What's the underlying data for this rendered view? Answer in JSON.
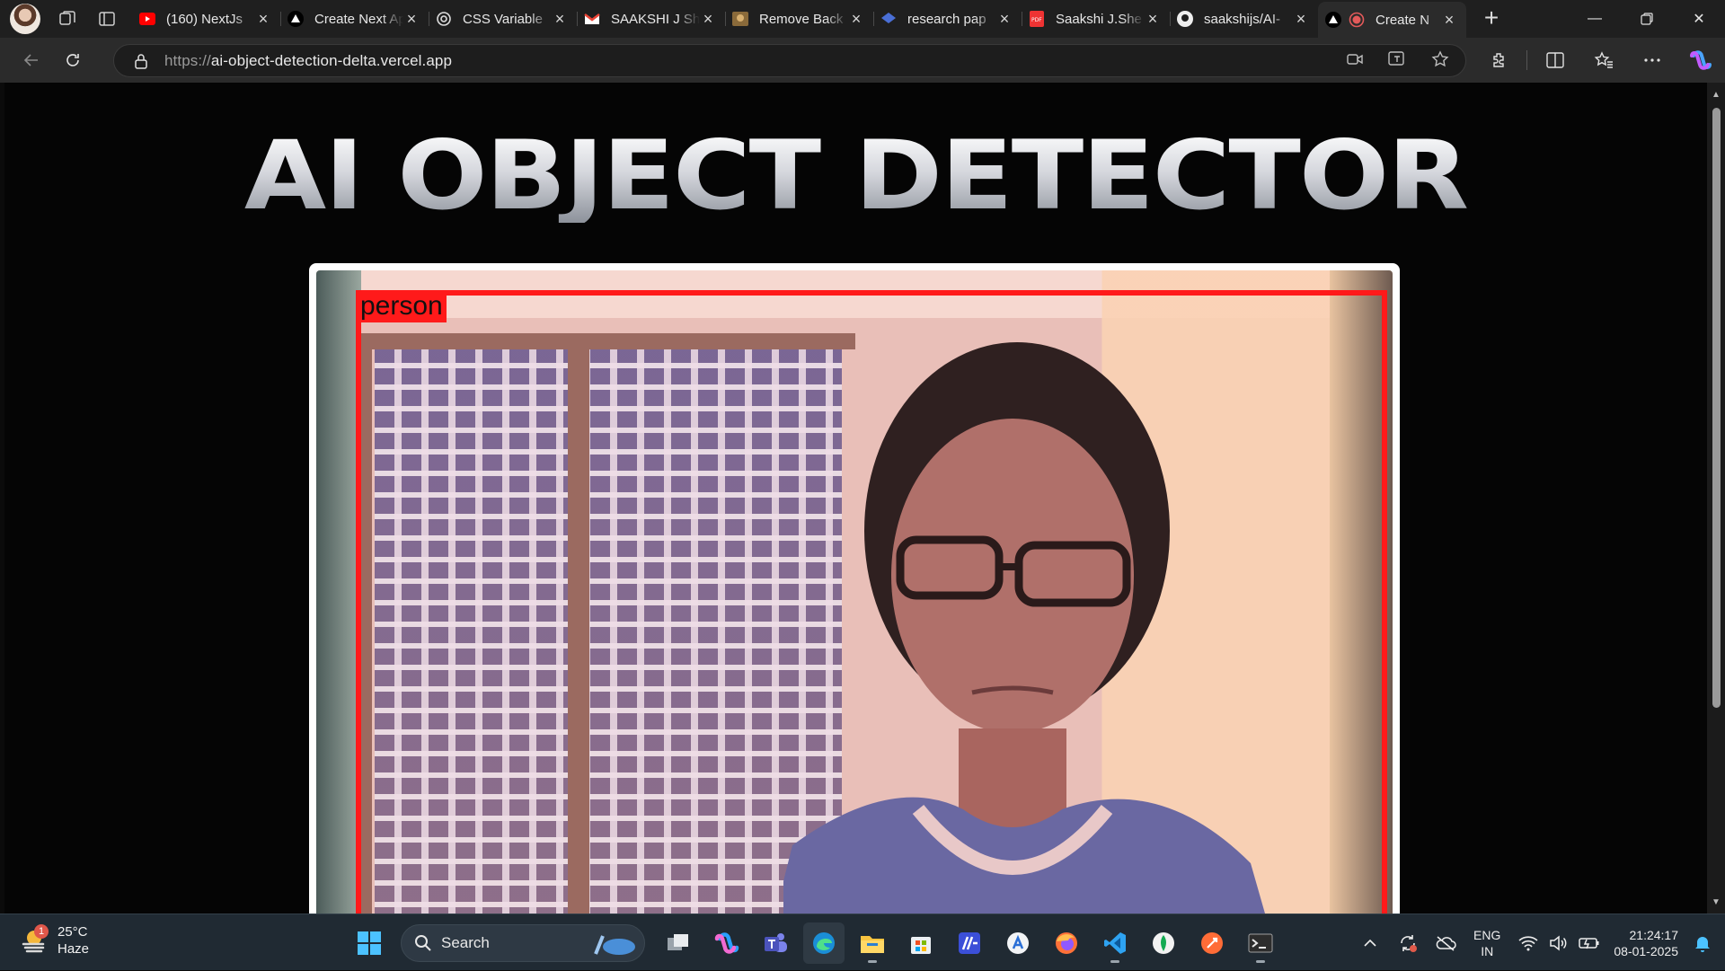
{
  "browser": {
    "tabs": [
      {
        "title": "(160) NextJs",
        "favicon": "youtube-icon",
        "active": false
      },
      {
        "title": "Create Next App",
        "favicon": "vercel-icon",
        "active": false
      },
      {
        "title": "CSS Variable",
        "favicon": "openai-icon",
        "active": false
      },
      {
        "title": "SAAKSHI J Sh",
        "favicon": "gmail-icon",
        "active": false
      },
      {
        "title": "Remove Back",
        "favicon": "removebg-icon",
        "active": false
      },
      {
        "title": "research pap",
        "favicon": "scholar-icon",
        "active": false
      },
      {
        "title": "Saakshi J.She",
        "favicon": "pdf-icon",
        "active": false
      },
      {
        "title": "saakshijs/AI-",
        "favicon": "github-icon",
        "active": false
      },
      {
        "title": "Create N",
        "favicon": "vercel-icon",
        "active": true,
        "recording": true
      }
    ],
    "url_scheme": "https://",
    "url_host": "ai-object-detection-delta.vercel.app"
  },
  "page": {
    "title": "AI OBJECT DETECTOR",
    "detections": [
      {
        "label": "person",
        "color": "#ff1a1a"
      }
    ]
  },
  "taskbar": {
    "weather": {
      "temp": "25°C",
      "condition": "Haze",
      "badge": "1"
    },
    "search_placeholder": "Search",
    "apps": [
      "windows-start-icon",
      "task-view-icon",
      "copilot-icon",
      "teams-icon",
      "edge-icon",
      "file-explorer-icon",
      "ms-store-icon",
      "mathpix-icon",
      "app-icon",
      "firefox-icon",
      "vscode-icon",
      "mongodb-compass-icon",
      "postman-icon",
      "terminal-icon"
    ],
    "lang_line1": "ENG",
    "lang_line2": "IN",
    "time": "21:24:17",
    "date": "08-01-2025"
  }
}
